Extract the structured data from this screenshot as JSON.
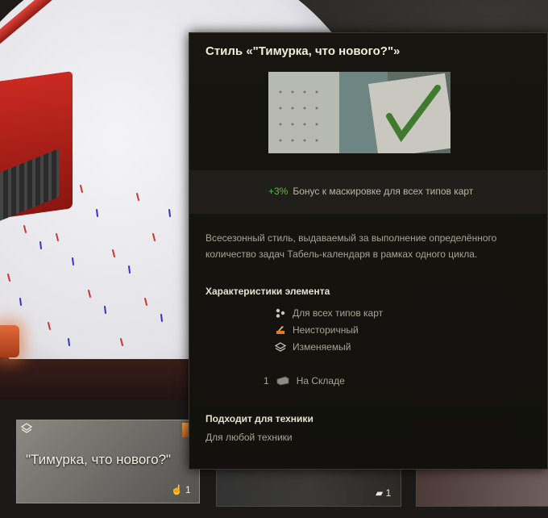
{
  "tooltip": {
    "title": "Стиль «\"Тимурка, что нового?\"»",
    "bonus_value": "+3%",
    "bonus_text": "Бонус к маскировке для всех типов карт",
    "description": "Всесезонный стиль, выдаваемый за выполнение определённого количество задач Табель-календаря в рамках одного цикла.",
    "characteristics_heading": "Характеристики элемента",
    "characteristics": [
      {
        "icon": "all-maps-icon",
        "label": "Для всех типов карт"
      },
      {
        "icon": "non-historical-icon",
        "label": "Неисторичный"
      },
      {
        "icon": "layers-icon",
        "label": "Изменяемый"
      }
    ],
    "stock_count": "1",
    "stock_label": "На Складе",
    "suitable_heading": "Подходит для техники",
    "suitable_text": "Для любой техники"
  },
  "carousel": {
    "selected_card": {
      "title": "\"Тимурка, что нового?\"",
      "count": "1"
    },
    "second_card": {
      "count": "1"
    }
  },
  "colors": {
    "bonus_green": "#5cbc3a",
    "tank_red": "#c92a22",
    "accent_orange": "#f08a3a"
  }
}
